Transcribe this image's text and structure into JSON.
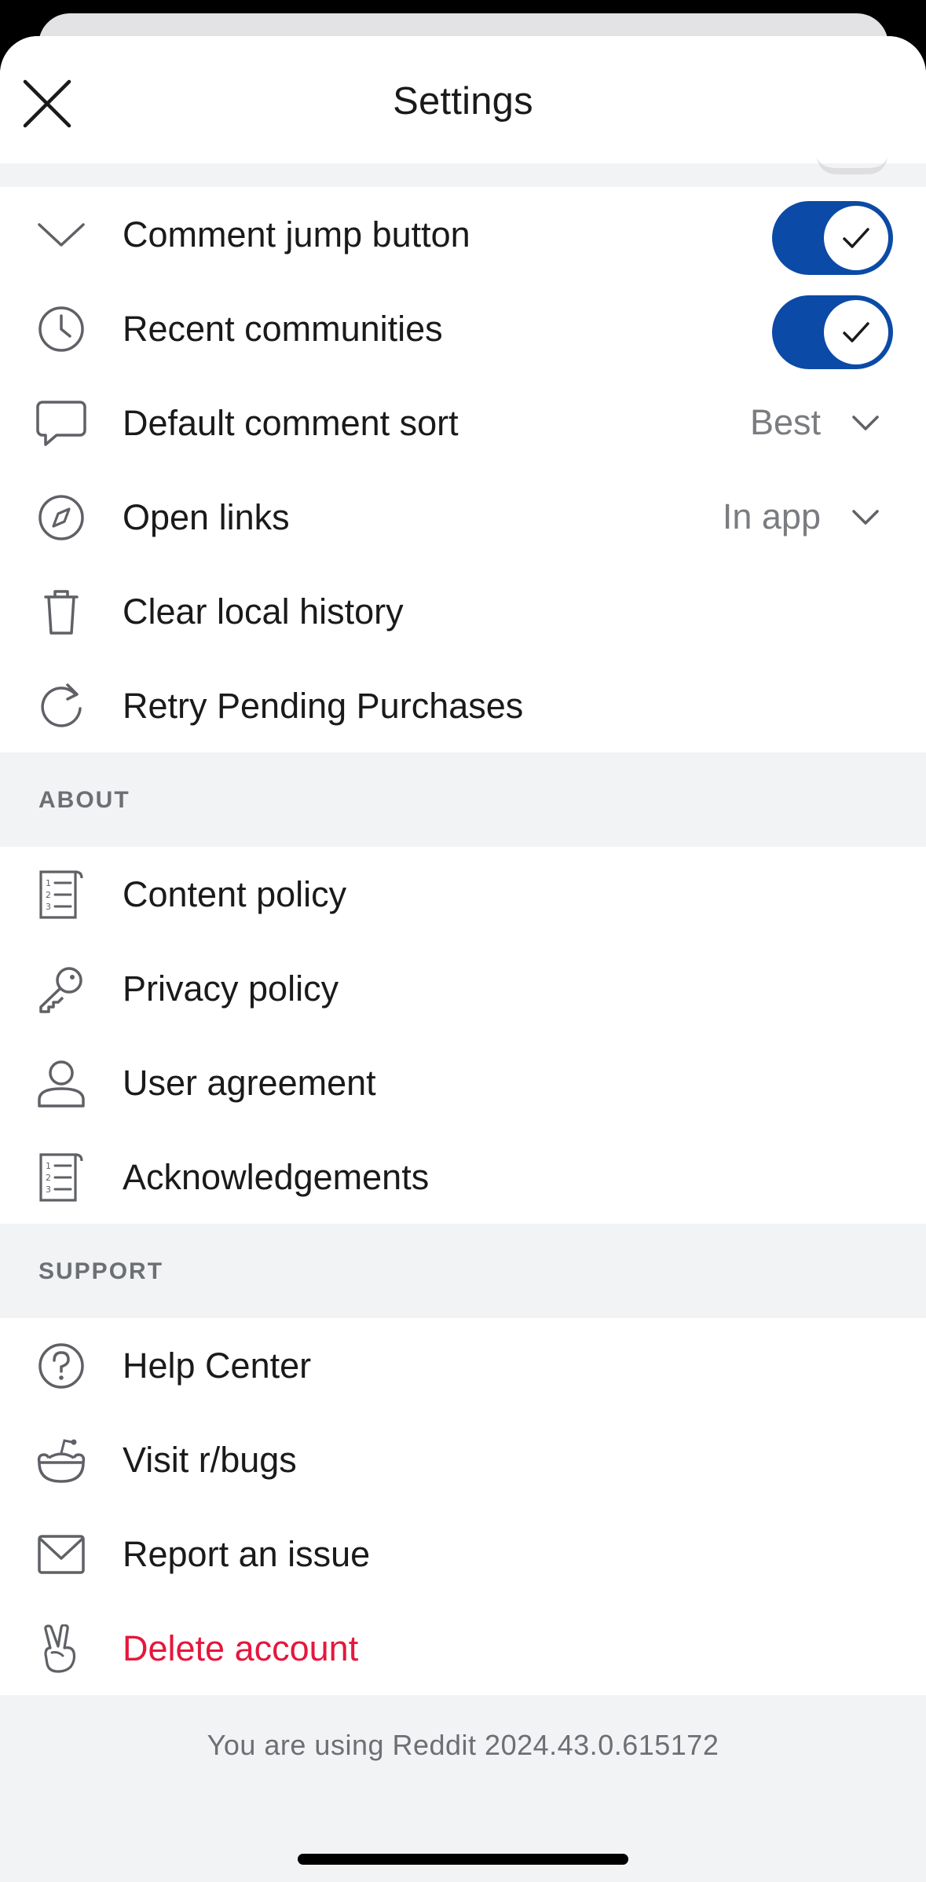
{
  "header": {
    "title": "Settings"
  },
  "rows_top": [
    {
      "icon": "chevron-down-icon",
      "label": "Comment jump button",
      "control": "toggle",
      "on": true
    },
    {
      "icon": "clock-icon",
      "label": "Recent communities",
      "control": "toggle",
      "on": true
    },
    {
      "icon": "comment-bubble-icon",
      "label": "Default comment sort",
      "control": "dropdown",
      "value": "Best"
    },
    {
      "icon": "compass-icon",
      "label": "Open links",
      "control": "dropdown",
      "value": "In app"
    },
    {
      "icon": "trash-icon",
      "label": "Clear local history"
    },
    {
      "icon": "refresh-icon",
      "label": "Retry Pending Purchases"
    }
  ],
  "about": {
    "heading": "ABOUT",
    "items": [
      {
        "icon": "numbered-list-icon",
        "label": "Content policy"
      },
      {
        "icon": "key-icon",
        "label": "Privacy policy"
      },
      {
        "icon": "user-icon",
        "label": "User agreement"
      },
      {
        "icon": "numbered-list-icon",
        "label": "Acknowledgements"
      }
    ]
  },
  "support": {
    "heading": "SUPPORT",
    "items": [
      {
        "icon": "help-circle-icon",
        "label": "Help Center"
      },
      {
        "icon": "reddit-alien-icon",
        "label": "Visit r/bugs"
      },
      {
        "icon": "mail-icon",
        "label": "Report an issue"
      },
      {
        "icon": "peace-hand-icon",
        "label": "Delete account"
      }
    ]
  },
  "footer": {
    "version_text": "You are using Reddit 2024.43.0.615172"
  },
  "colors": {
    "toggle_on": "#0b4aa6",
    "danger": "#e5173d",
    "background": "#f2f3f5"
  }
}
